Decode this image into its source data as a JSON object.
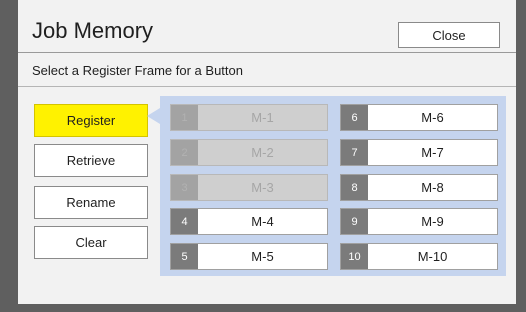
{
  "dialog": {
    "title": "Job Memory",
    "close_label": "Close",
    "instruction": "Select a Register Frame for a Button"
  },
  "actions": {
    "register": "Register",
    "retrieve": "Retrieve",
    "rename": "Rename",
    "clear": "Clear",
    "selected": "Register"
  },
  "slots": [
    {
      "number": "1",
      "label": "M-1",
      "enabled": false
    },
    {
      "number": "2",
      "label": "M-2",
      "enabled": false
    },
    {
      "number": "3",
      "label": "M-3",
      "enabled": false
    },
    {
      "number": "4",
      "label": "M-4",
      "enabled": true
    },
    {
      "number": "5",
      "label": "M-5",
      "enabled": true
    },
    {
      "number": "6",
      "label": "M-6",
      "enabled": true
    },
    {
      "number": "7",
      "label": "M-7",
      "enabled": true
    },
    {
      "number": "8",
      "label": "M-8",
      "enabled": true
    },
    {
      "number": "9",
      "label": "M-9",
      "enabled": true
    },
    {
      "number": "10",
      "label": "M-10",
      "enabled": true
    }
  ],
  "colors": {
    "selected_button": "#fff200",
    "panel_background": "#c5d4ee",
    "slot_number_background": "#7b7b7b",
    "disabled_slot": "#cfcfcf"
  }
}
